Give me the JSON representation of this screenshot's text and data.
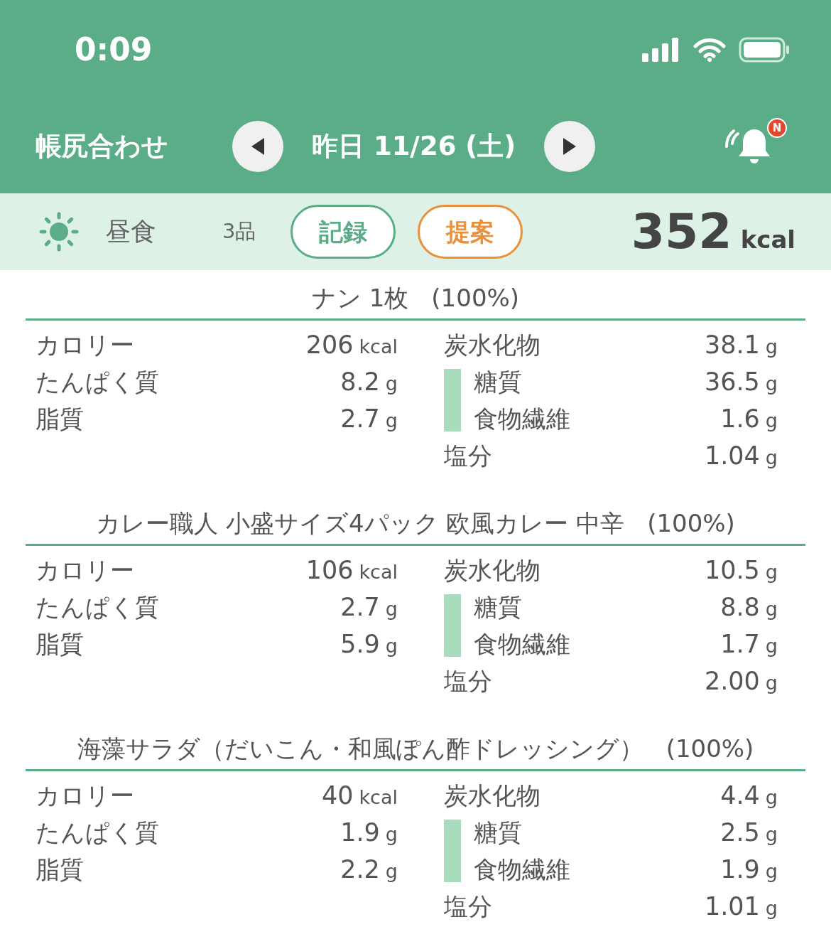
{
  "status_bar": {
    "time": "0:09"
  },
  "header": {
    "title": "帳尻合わせ",
    "date": "昨日 11/26 (土)",
    "badge": "N"
  },
  "meal": {
    "name": "昼食",
    "count": "3品",
    "buttons": [
      {
        "label": "記録",
        "kind": "record"
      },
      {
        "label": "提案",
        "kind": "suggest"
      }
    ],
    "calories": "352",
    "unit": "kcal"
  },
  "foods": [
    {
      "name": "ナン 1枚",
      "portion": "(100%)",
      "left": [
        {
          "label": "カロリー",
          "value": "206",
          "unit": "kcal"
        },
        {
          "label": "たんぱく質",
          "value": "8.2",
          "unit": "g"
        },
        {
          "label": "脂質",
          "value": "2.7",
          "unit": "g"
        }
      ],
      "right": [
        {
          "label": "炭水化物",
          "value": "38.1",
          "unit": "g",
          "kind": "main"
        },
        {
          "label": "糖質",
          "value": "36.5",
          "unit": "g",
          "kind": "sub"
        },
        {
          "label": "食物繊維",
          "value": "1.6",
          "unit": "g",
          "kind": "sub"
        },
        {
          "label": "塩分",
          "value": "1.04",
          "unit": "g",
          "kind": "main"
        }
      ]
    },
    {
      "name": "カレー職人 小盛サイズ4パック 欧風カレー 中辛",
      "portion": "(100%)",
      "left": [
        {
          "label": "カロリー",
          "value": "106",
          "unit": "kcal"
        },
        {
          "label": "たんぱく質",
          "value": "2.7",
          "unit": "g"
        },
        {
          "label": "脂質",
          "value": "5.9",
          "unit": "g"
        }
      ],
      "right": [
        {
          "label": "炭水化物",
          "value": "10.5",
          "unit": "g",
          "kind": "main"
        },
        {
          "label": "糖質",
          "value": "8.8",
          "unit": "g",
          "kind": "sub"
        },
        {
          "label": "食物繊維",
          "value": "1.7",
          "unit": "g",
          "kind": "sub"
        },
        {
          "label": "塩分",
          "value": "2.00",
          "unit": "g",
          "kind": "main"
        }
      ]
    },
    {
      "name": "海藻サラダ（だいこん・和風ぽん酢ドレッシング）",
      "portion": "(100%)",
      "left": [
        {
          "label": "カロリー",
          "value": "40",
          "unit": "kcal"
        },
        {
          "label": "たんぱく質",
          "value": "1.9",
          "unit": "g"
        },
        {
          "label": "脂質",
          "value": "2.2",
          "unit": "g"
        }
      ],
      "right": [
        {
          "label": "炭水化物",
          "value": "4.4",
          "unit": "g",
          "kind": "main"
        },
        {
          "label": "糖質",
          "value": "2.5",
          "unit": "g",
          "kind": "sub"
        },
        {
          "label": "食物繊維",
          "value": "1.9",
          "unit": "g",
          "kind": "sub"
        },
        {
          "label": "塩分",
          "value": "1.01",
          "unit": "g",
          "kind": "main"
        }
      ]
    }
  ]
}
